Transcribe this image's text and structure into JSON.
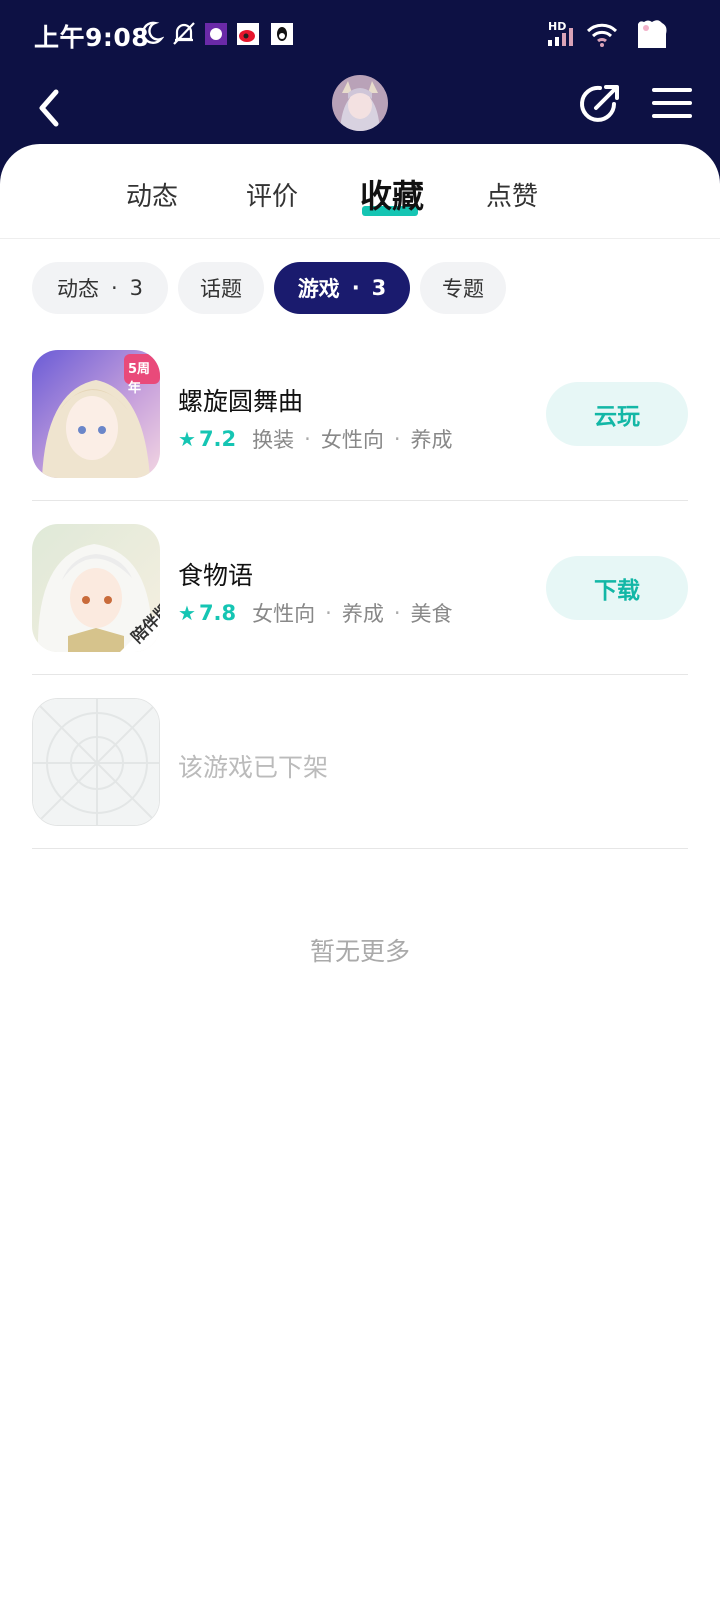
{
  "status_bar": {
    "time": "上午9:08",
    "network_label": "HD",
    "icons": [
      "moon-icon",
      "mute-bell-icon",
      "app-notification-icon",
      "weibo-icon",
      "qq-icon",
      "signal-icon",
      "wifi-icon",
      "battery-icon"
    ]
  },
  "header": {
    "avatar": "user-avatar",
    "icons": [
      "back-icon",
      "share-icon",
      "menu-icon"
    ]
  },
  "tabs": [
    {
      "label": "动态",
      "active": false
    },
    {
      "label": "评价",
      "active": false
    },
    {
      "label": "收藏",
      "active": true
    },
    {
      "label": "点赞",
      "active": false
    }
  ],
  "filters": [
    {
      "label": "动态",
      "count": "3",
      "active": false
    },
    {
      "label": "话题",
      "count": "",
      "active": false
    },
    {
      "label": "游戏",
      "count": "3",
      "active": true
    },
    {
      "label": "专题",
      "count": "",
      "active": false
    }
  ],
  "filter_separator": "·",
  "games": [
    {
      "title": "螺旋圆舞曲",
      "rating": "7.2",
      "tags": [
        "换装",
        "女性向",
        "养成"
      ],
      "action": "云玩",
      "icon_badge": "5周年"
    },
    {
      "title": "食物语",
      "rating": "7.8",
      "tags": [
        "女性向",
        "养成",
        "美食"
      ],
      "action": "下载",
      "icon_badge": "陪伴版"
    },
    {
      "title": "该游戏已下架",
      "removed": true
    }
  ],
  "list_end_text": "暂无更多",
  "colors": {
    "header_bg": "#0d1144",
    "accent": "#15c5b3",
    "active_chip": "#1a1b6e"
  }
}
